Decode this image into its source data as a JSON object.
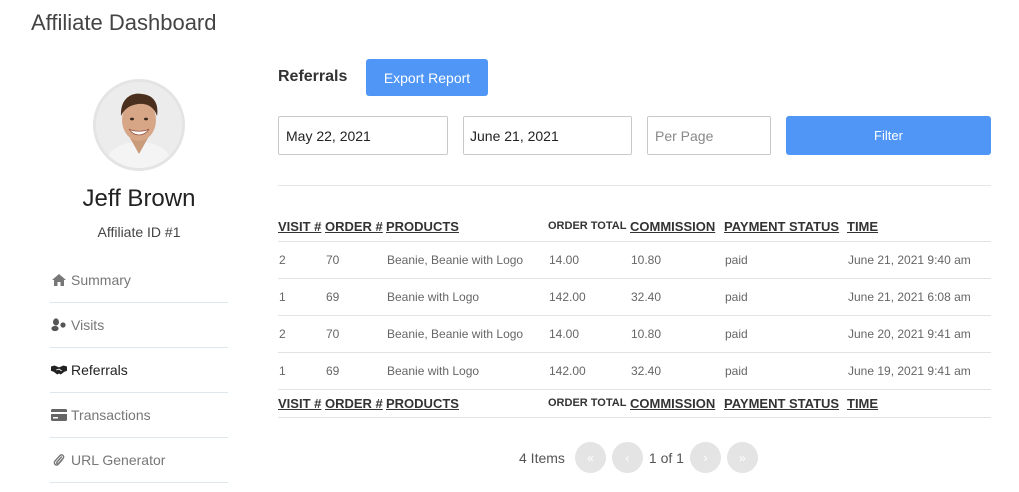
{
  "page": {
    "title": "Affiliate Dashboard"
  },
  "profile": {
    "name": "Jeff Brown",
    "affiliate_id": "Affiliate ID #1"
  },
  "nav": {
    "items": [
      {
        "label": "Summary",
        "icon": "home-icon"
      },
      {
        "label": "Visits",
        "icon": "footprints-icon"
      },
      {
        "label": "Referrals",
        "icon": "handshake-icon"
      },
      {
        "label": "Transactions",
        "icon": "credit-card-icon"
      },
      {
        "label": "URL Generator",
        "icon": "paperclip-icon"
      }
    ],
    "active": "Referrals"
  },
  "referrals": {
    "title": "Referrals",
    "export_label": "Export Report",
    "filter": {
      "start_date": "May 22, 2021",
      "end_date": "June 21, 2021",
      "per_page_placeholder": "Per Page",
      "filter_label": "Filter"
    },
    "columns": [
      "VISIT #",
      "ORDER #",
      "PRODUCTS",
      "ORDER TOTAL",
      "COMMISSION",
      "PAYMENT STATUS",
      "TIME"
    ],
    "rows": [
      [
        "2",
        "70",
        "Beanie, Beanie with Logo",
        "14.00",
        "10.80",
        "paid",
        "June 21, 2021 9:40 am"
      ],
      [
        "1",
        "69",
        "Beanie with Logo",
        "142.00",
        "32.40",
        "paid",
        "June 21, 2021 6:08 am"
      ],
      [
        "2",
        "70",
        "Beanie, Beanie with Logo",
        "14.00",
        "10.80",
        "paid",
        "June 20, 2021 9:41 am"
      ],
      [
        "1",
        "69",
        "Beanie with Logo",
        "142.00",
        "32.40",
        "paid",
        "June 19, 2021 9:41 am"
      ]
    ]
  },
  "pagination": {
    "items": "4 Items",
    "page_text": "1 of 1",
    "first": "«",
    "prev": "‹",
    "next": "›",
    "last": "»"
  },
  "colors": {
    "accent": "#4f96f7",
    "divider": "#dde8ee",
    "pager": "#e4e4e4"
  }
}
